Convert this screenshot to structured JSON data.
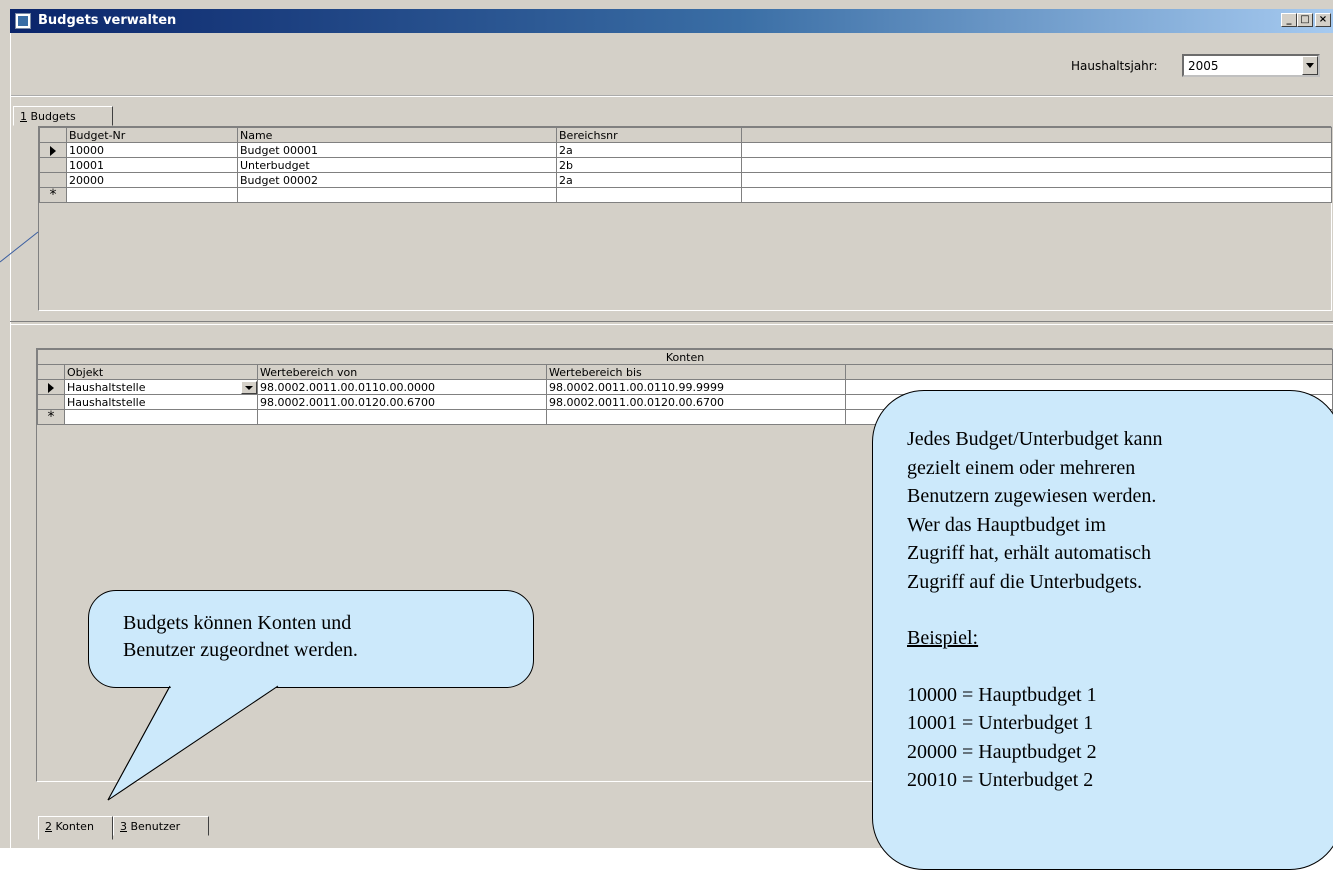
{
  "window": {
    "title": "Budgets verwalten",
    "buttons": {
      "minimize": "_",
      "maximize": "□",
      "close": "×"
    }
  },
  "header": {
    "year_label": "Haushaltsjahr:",
    "year_value": "2005"
  },
  "tabs_top": [
    {
      "accel": "1",
      "label": " Budgets"
    }
  ],
  "budgets_grid": {
    "columns": [
      "Budget-Nr",
      "Name",
      "Bereichsnr",
      ""
    ],
    "rows": [
      {
        "nr": "10000",
        "name": "Budget 00001",
        "bereich": "2a",
        "current": true
      },
      {
        "nr": "10001",
        "name": "Unterbudget",
        "bereich": "2b",
        "current": false
      },
      {
        "nr": "20000",
        "name": "Budget 00002",
        "bereich": "2a",
        "current": false
      }
    ],
    "new_row_marker": "*"
  },
  "konten_grid": {
    "caption": "Konten",
    "columns": [
      "Objekt",
      "Wertebereich von",
      "Wertebereich bis",
      ""
    ],
    "rows": [
      {
        "objekt": "Haushaltstelle",
        "von": "98.0002.0011.00.0110.00.0000",
        "bis": "98.0002.0011.00.0110.99.9999",
        "current": true
      },
      {
        "objekt": "Haushaltstelle",
        "von": "98.0002.0011.00.0120.00.6700",
        "bis": "98.0002.0011.00.0120.00.6700",
        "current": false
      }
    ],
    "new_row_marker": "*"
  },
  "tabs_bottom": [
    {
      "accel": "2",
      "label": " Konten"
    },
    {
      "accel": "3",
      "label": " Benutzer"
    }
  ],
  "callouts": {
    "left": [
      "Budgets können Konten und",
      "Benutzer zugeordnet werden."
    ],
    "right": {
      "lines": [
        "Jedes Budget/Unterbudget kann",
        "gezielt einem oder mehreren",
        "Benutzern zugewiesen werden.",
        "Wer das Hauptbudget im",
        "Zugriff hat, erhält automatisch",
        "Zugriff auf die Unterbudgets."
      ],
      "example_heading": "Beispiel:",
      "example_lines": [
        "10000 = Hauptbudget 1",
        "10001 = Unterbudget 1",
        "20000 = Hauptbudget 2",
        "20010 = Unterbudget 2"
      ]
    }
  },
  "colors": {
    "callout_fill": "#cce9fb",
    "titlebar_start": "#0a246a",
    "window_face": "#d4d0c8"
  }
}
